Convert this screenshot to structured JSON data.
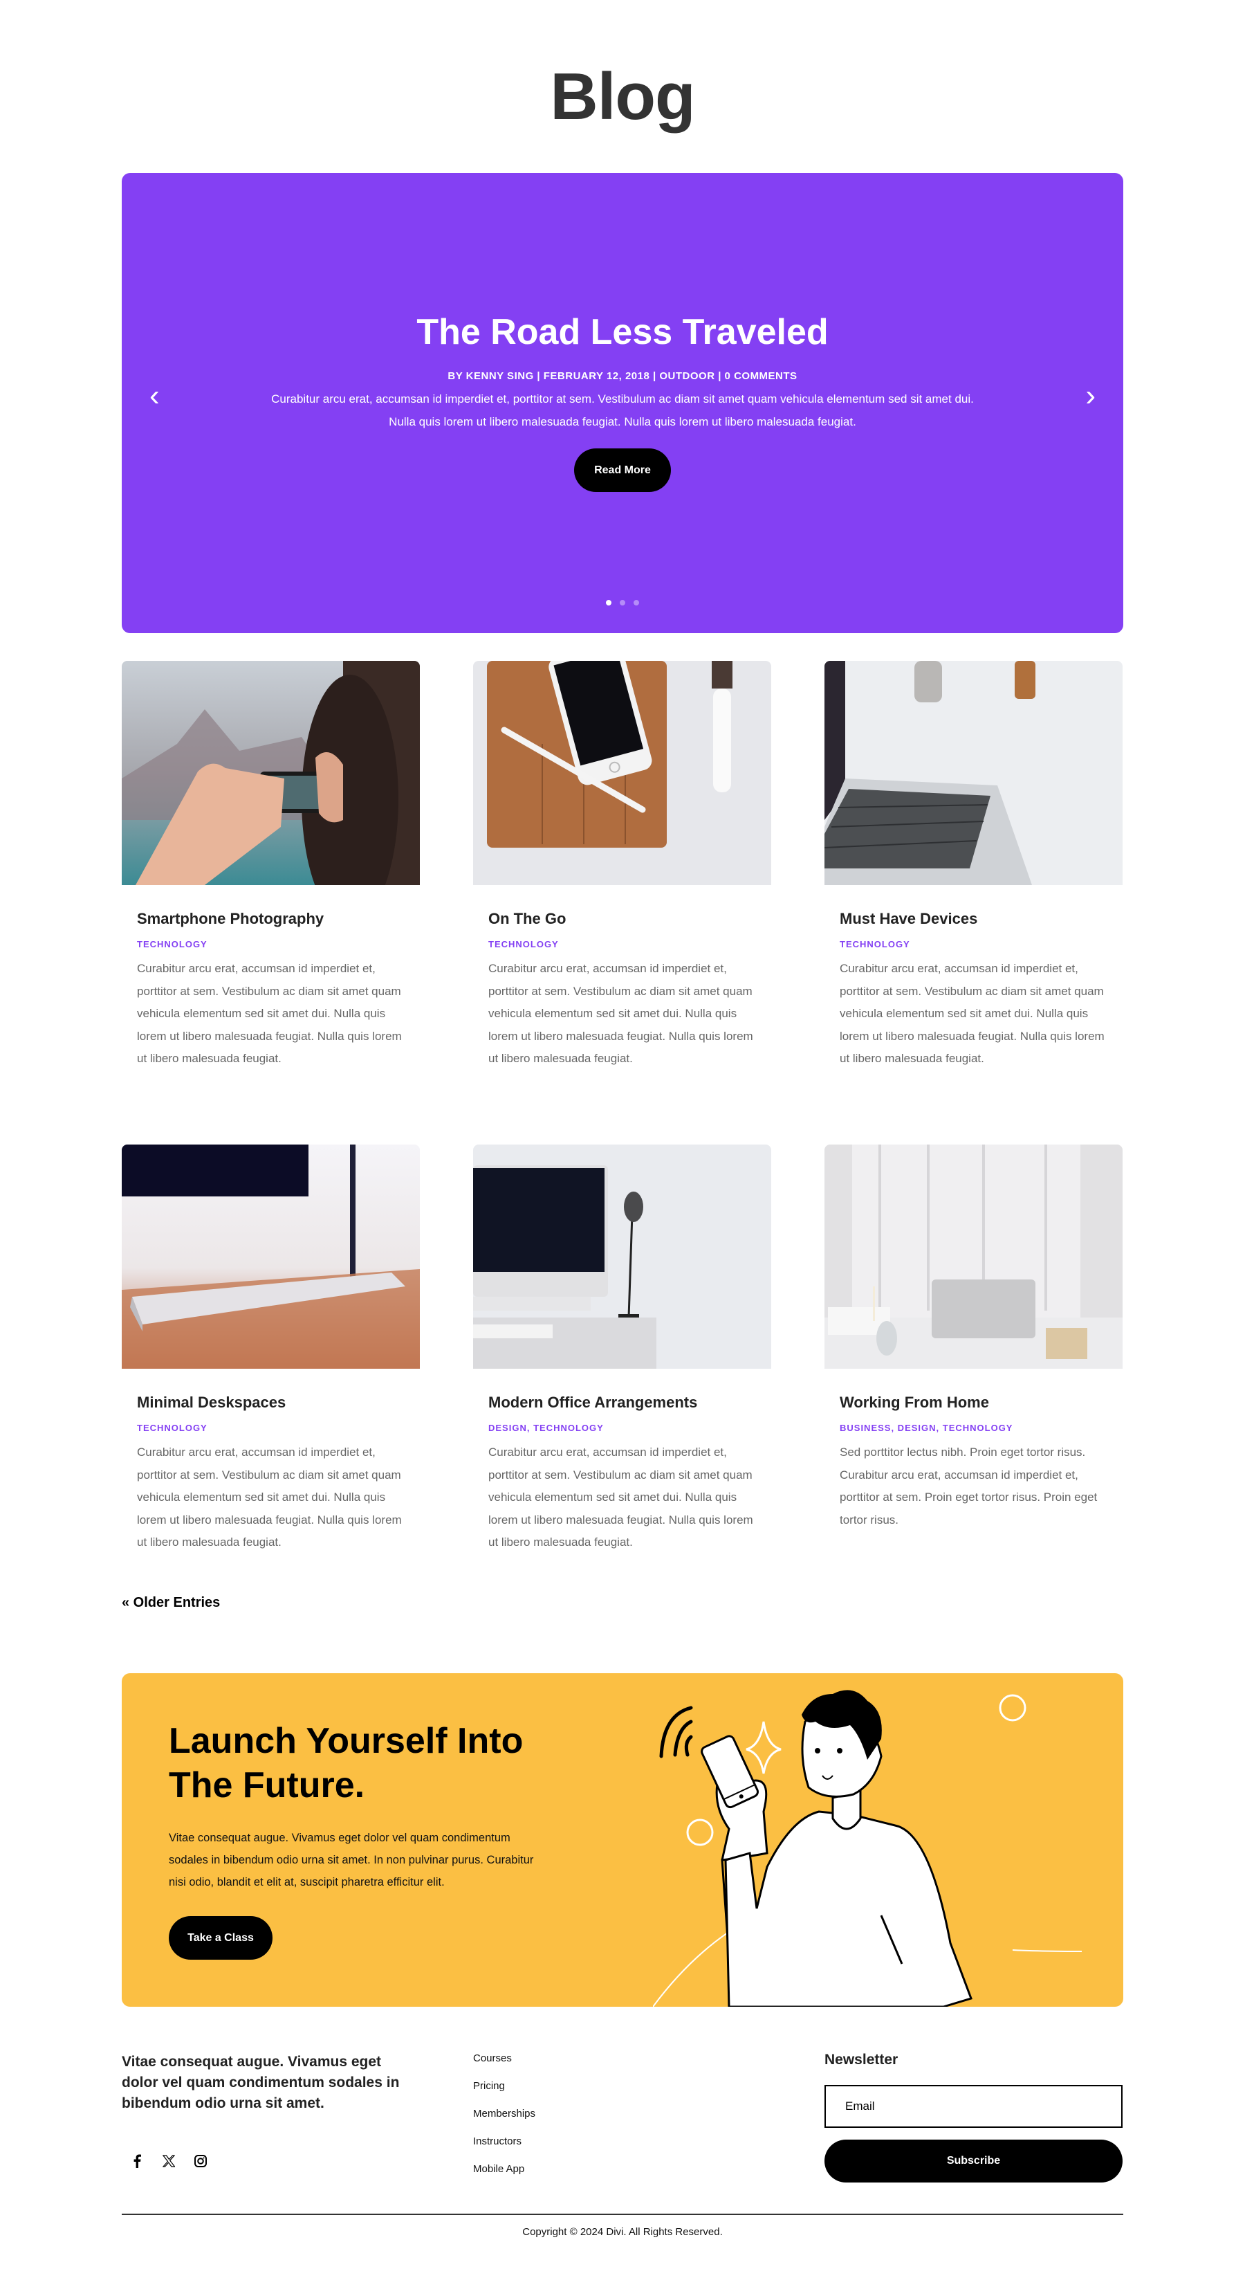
{
  "page": {
    "title": "Blog"
  },
  "colors": {
    "accent": "#8440f3",
    "cta_bg": "#fbbf43",
    "button": "#000000"
  },
  "slider": {
    "title": "The Road Less Traveled",
    "meta": "BY KENNY SING | FEBRUARY 12, 2018 | OUTDOOR | 0 COMMENTS",
    "excerpt_line1": "Curabitur arcu erat, accumsan id imperdiet et, porttitor at sem. Vestibulum ac diam sit amet quam vehicula elementum sed sit amet dui.",
    "excerpt_line2": "Nulla quis lorem ut libero malesuada feugiat. Nulla quis lorem ut libero malesuada feugiat.",
    "button_label": "Read More",
    "prev_icon": "‹",
    "next_icon": "›",
    "slide_count": 3,
    "active_slide": 1
  },
  "posts": [
    {
      "title": "Smartphone Photography",
      "categories": "TECHNOLOGY",
      "image": "hands-holding-smartphone-photo",
      "excerpt": "Curabitur arcu erat, accumsan id imperdiet et, porttitor at sem. Vestibulum ac diam sit amet quam vehicula elementum sed sit amet dui. Nulla quis lorem ut libero malesuada feugiat. Nulla quis lorem ut libero malesuada feugiat."
    },
    {
      "title": "On The Go",
      "categories": "TECHNOLOGY",
      "image": "phone-tablet-pencil-watch-photo",
      "excerpt": "Curabitur arcu erat, accumsan id imperdiet et, porttitor at sem. Vestibulum ac diam sit amet quam vehicula elementum sed sit amet dui. Nulla quis lorem ut libero malesuada feugiat. Nulla quis lorem ut libero malesuada feugiat."
    },
    {
      "title": "Must Have Devices",
      "categories": "TECHNOLOGY",
      "image": "laptop-keyboard-photo",
      "excerpt": "Curabitur arcu erat, accumsan id imperdiet et, porttitor at sem. Vestibulum ac diam sit amet quam vehicula elementum sed sit amet dui. Nulla quis lorem ut libero malesuada feugiat. Nulla quis lorem ut libero malesuada feugiat."
    },
    {
      "title": "Minimal Deskspaces",
      "categories": "TECHNOLOGY",
      "image": "wireless-keyboard-desk-photo",
      "excerpt": "Curabitur arcu erat, accumsan id imperdiet et, porttitor at sem. Vestibulum ac diam sit amet quam vehicula elementum sed sit amet dui. Nulla quis lorem ut libero malesuada feugiat. Nulla quis lorem ut libero malesuada feugiat."
    },
    {
      "title": "Modern Office Arrangements",
      "categories": "DESIGN, TECHNOLOGY",
      "image": "imac-lamp-desk-photo",
      "excerpt": "Curabitur arcu erat, accumsan id imperdiet et, porttitor at sem. Vestibulum ac diam sit amet quam vehicula elementum sed sit amet dui. Nulla quis lorem ut libero malesuada feugiat. Nulla quis lorem ut libero malesuada feugiat."
    },
    {
      "title": "Working From Home",
      "categories": "BUSINESS, DESIGN, TECHNOLOGY",
      "image": "laptop-home-desk-photo",
      "excerpt": "Sed porttitor lectus nibh. Proin eget tortor risus. Curabitur arcu erat, accumsan id imperdiet et, porttitor at sem. Proin eget tortor risus. Proin eget tortor risus."
    }
  ],
  "pagination": {
    "older_entries": "« Older Entries"
  },
  "cta": {
    "title_line1": "Launch Yourself Into",
    "title_line2": "The Future.",
    "text": "Vitae consequat augue. Vivamus eget dolor vel quam condimentum sodales in bibendum odio urna sit amet. In non pulvinar purus. Curabitur nisi odio, blandit et elit at, suscipit pharetra efficitur elit.",
    "button_label": "Take a Class",
    "illustration": "man-holding-phone-illustration"
  },
  "footer": {
    "tagline": "Vitae consequat augue. Vivamus eget dolor vel quam condimentum sodales in bibendum odio urna sit amet.",
    "socials": [
      "facebook-icon",
      "x-icon",
      "instagram-icon"
    ],
    "links": [
      "Courses",
      "Pricing",
      "Memberships",
      "Instructors",
      "Mobile App"
    ],
    "newsletter": {
      "title": "Newsletter",
      "email_placeholder": "Email",
      "email_value": "",
      "button_label": "Subscribe"
    },
    "copyright": "Copyright © 2024 Divi. All Rights Reserved."
  }
}
